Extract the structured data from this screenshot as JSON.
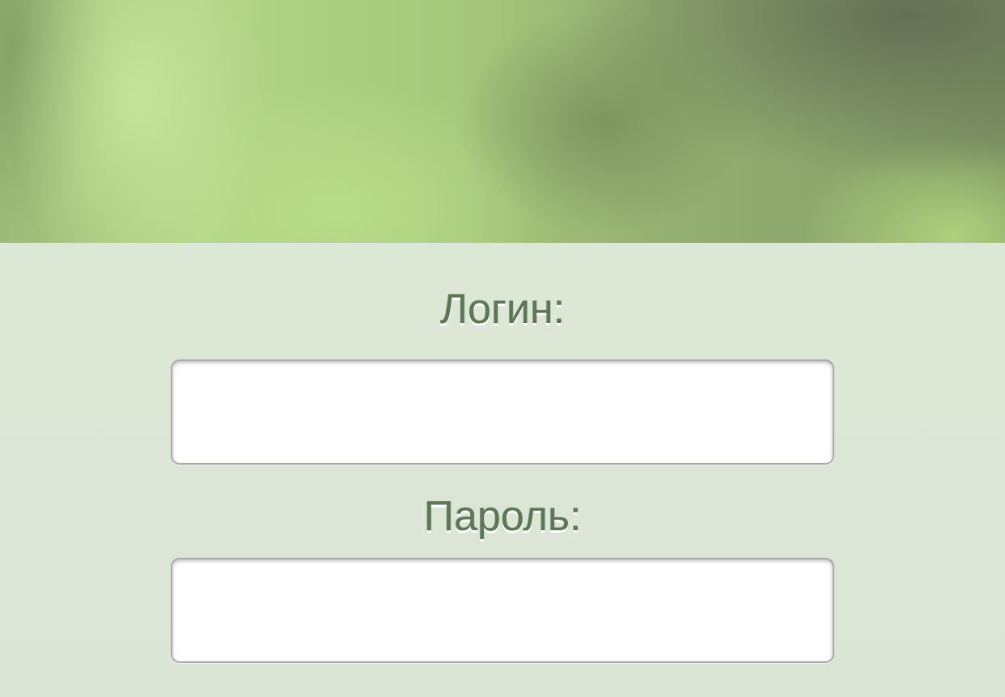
{
  "header": {
    "banner_image": "green-blurred-banner"
  },
  "form": {
    "login_label": "Логин:",
    "login_value": "",
    "password_label": "Пароль:",
    "password_value": ""
  },
  "colors": {
    "label_text": "#5d7655",
    "background": "#dde9d7",
    "input_border": "#a9aba8"
  }
}
